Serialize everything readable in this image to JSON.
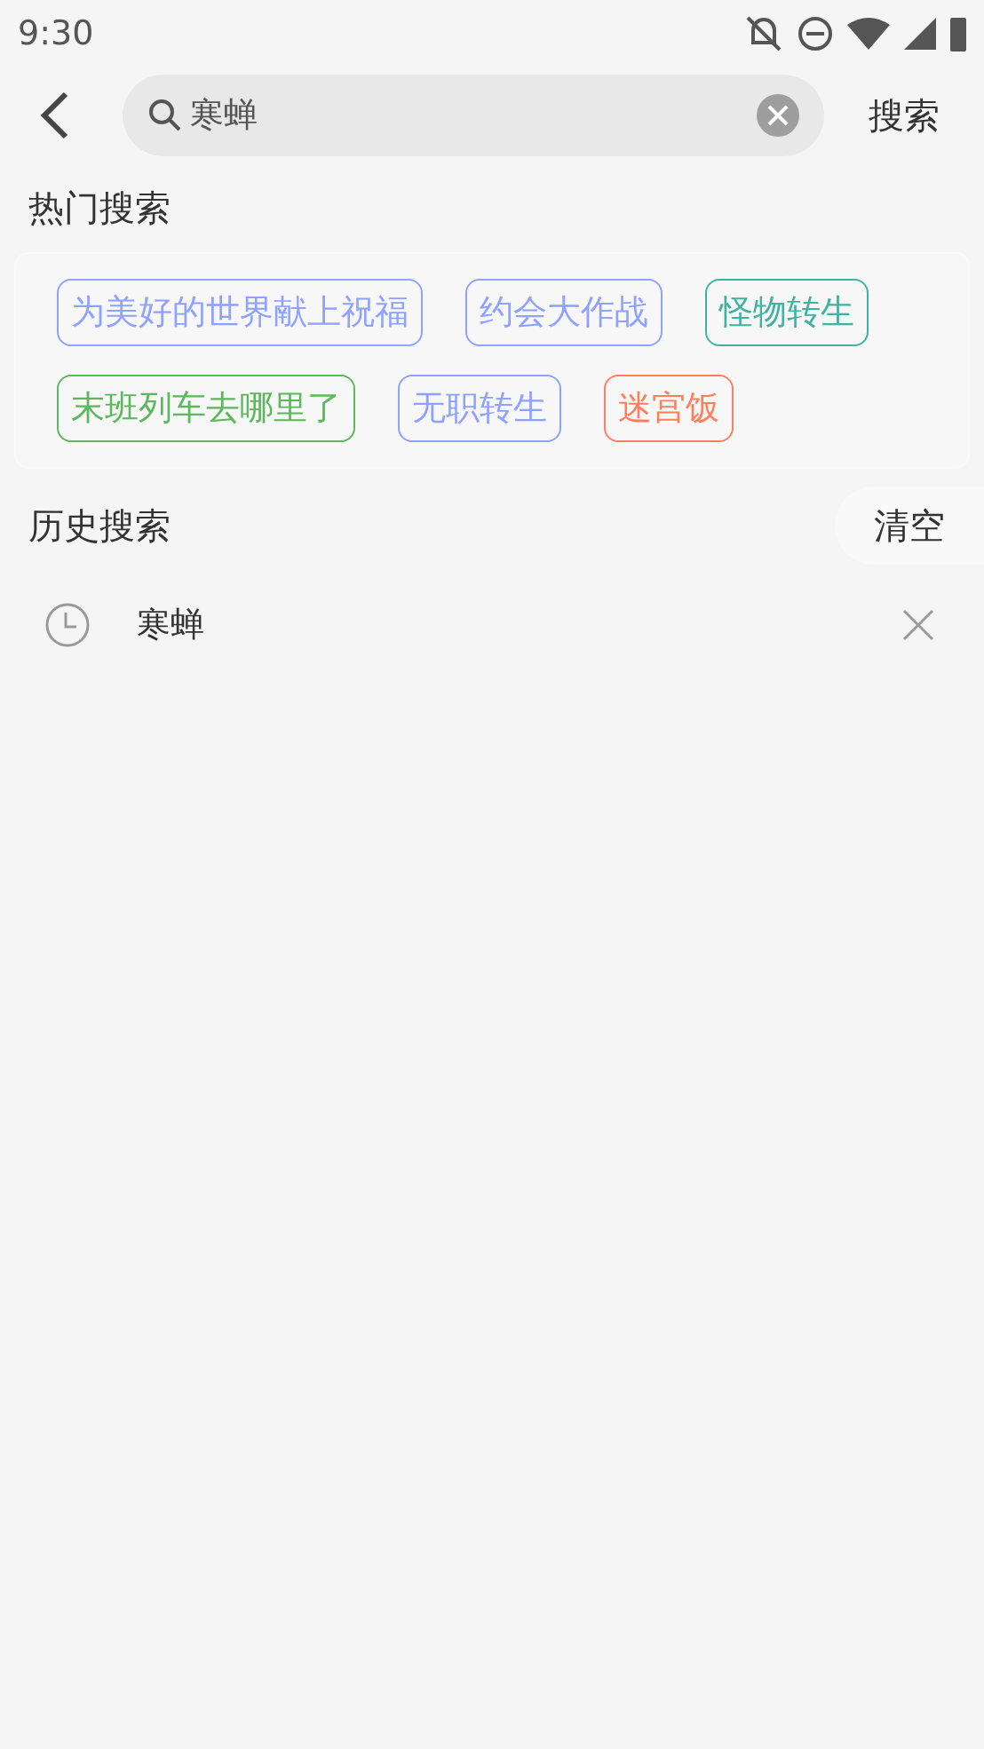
{
  "status_bar": {
    "time": "9:30"
  },
  "search": {
    "value": "寒蝉",
    "button": "搜索"
  },
  "hot": {
    "title": "热门搜索",
    "tags": [
      {
        "label": "为美好的世界献上祝福",
        "color": "#8fa2ff"
      },
      {
        "label": "约会大作战",
        "color": "#8fa2ff"
      },
      {
        "label": "怪物转生",
        "color": "#3fb39f"
      },
      {
        "label": "末班列车去哪里了",
        "color": "#5cb85c"
      },
      {
        "label": "无职转生",
        "color": "#8fa2ff"
      },
      {
        "label": "迷宫饭",
        "color": "#ff7f5c"
      }
    ]
  },
  "history": {
    "title": "历史搜索",
    "clear": "清空",
    "items": [
      {
        "label": "寒蝉"
      }
    ]
  }
}
